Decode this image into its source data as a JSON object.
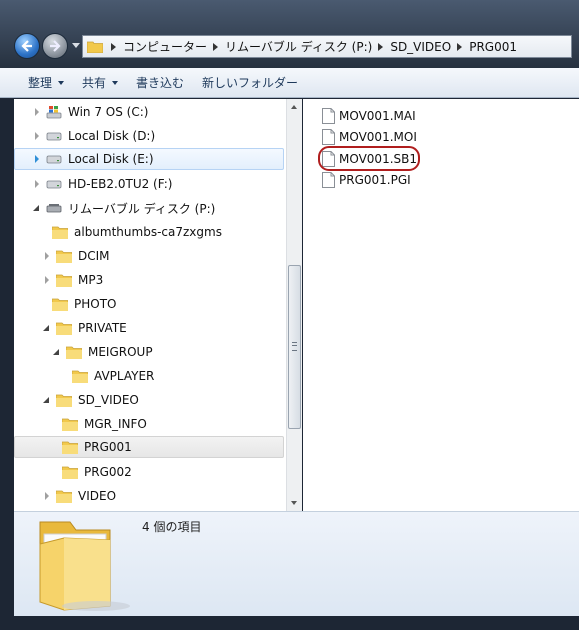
{
  "address": {
    "crumbs": [
      "コンピューター",
      "リムーバブル ディスク (P:)",
      "SD_VIDEO",
      "PRG001"
    ]
  },
  "toolbar": {
    "organize": "整理",
    "share": "共有",
    "burn": "書き込む",
    "new_folder": "新しいフォルダー"
  },
  "tree": {
    "items": [
      {
        "label": "Win 7 OS (C:)",
        "icon": "windows-drive-icon",
        "expander": "collapsed"
      },
      {
        "label": "Local Disk (D:)",
        "icon": "drive-icon",
        "expander": "collapsed"
      },
      {
        "label": "Local Disk (E:)",
        "icon": "drive-icon",
        "expander": "collapsed",
        "state": "hover"
      },
      {
        "label": "HD-EB2.0TU2 (F:)",
        "icon": "drive-icon",
        "expander": "collapsed"
      },
      {
        "label": "リムーバブル ディスク (P:)",
        "icon": "removable-drive-icon",
        "expander": "expanded"
      },
      {
        "label": "albumthumbs-ca7zxgms",
        "icon": "folder-icon",
        "expander": "none"
      },
      {
        "label": "DCIM",
        "icon": "folder-icon",
        "expander": "collapsed"
      },
      {
        "label": "MP3",
        "icon": "folder-icon",
        "expander": "collapsed"
      },
      {
        "label": "PHOTO",
        "icon": "folder-icon",
        "expander": "none"
      },
      {
        "label": "PRIVATE",
        "icon": "folder-icon",
        "expander": "expanded"
      },
      {
        "label": "MEIGROUP",
        "icon": "folder-icon",
        "expander": "expanded"
      },
      {
        "label": "AVPLAYER",
        "icon": "folder-icon",
        "expander": "none"
      },
      {
        "label": "SD_VIDEO",
        "icon": "folder-icon",
        "expander": "expanded"
      },
      {
        "label": "MGR_INFO",
        "icon": "folder-icon",
        "expander": "none"
      },
      {
        "label": "PRG001",
        "icon": "folder-icon",
        "expander": "none",
        "state": "selected"
      },
      {
        "label": "PRG002",
        "icon": "folder-icon",
        "expander": "none"
      },
      {
        "label": "VIDEO",
        "icon": "folder-icon",
        "expander": "collapsed"
      }
    ]
  },
  "files": {
    "items": [
      {
        "name": "MOV001.MAI",
        "icon": "file-icon"
      },
      {
        "name": "MOV001.MOI",
        "icon": "file-icon"
      },
      {
        "name": "MOV001.SB1",
        "icon": "file-icon",
        "circled": true
      },
      {
        "name": "PRG001.PGI",
        "icon": "file-icon"
      }
    ]
  },
  "details": {
    "count": "4 個の項目",
    "icon": "large-folder-icon"
  },
  "colors": {
    "highlight_border": "#b6d3f4",
    "annotation_red": "#b01e1e",
    "folder_yellow": "#f2c94c"
  }
}
